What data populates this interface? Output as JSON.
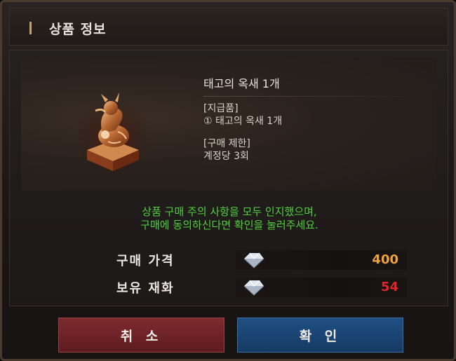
{
  "dialog": {
    "title": "상품 정보"
  },
  "item": {
    "image_icon": "jade-seal-icon",
    "name": "태고의 옥새 1개",
    "reward_heading": "[지급품]",
    "reward_line": "① 태고의 옥새 1개",
    "limit_heading": "[구매 제한]",
    "limit_line": "계정당 3회"
  },
  "notice": {
    "line1": "상품 구매 주의 사항을 모두 인지했으며,",
    "line2": "구매에 동의하신다면 확인을 눌러주세요.",
    "color": "#4ed13b"
  },
  "price": {
    "label": "구매 가격",
    "currency_icon": "diamond-icon",
    "value": "400",
    "value_color": "#f0a23a"
  },
  "owned": {
    "label": "보유 재화",
    "currency_icon": "diamond-icon",
    "value": "54",
    "value_color": "#e0262a"
  },
  "buttons": {
    "cancel_label": "취 소",
    "confirm_label": "확 인",
    "cancel_color": "#7e2a2e",
    "confirm_color": "#1f4f84"
  }
}
